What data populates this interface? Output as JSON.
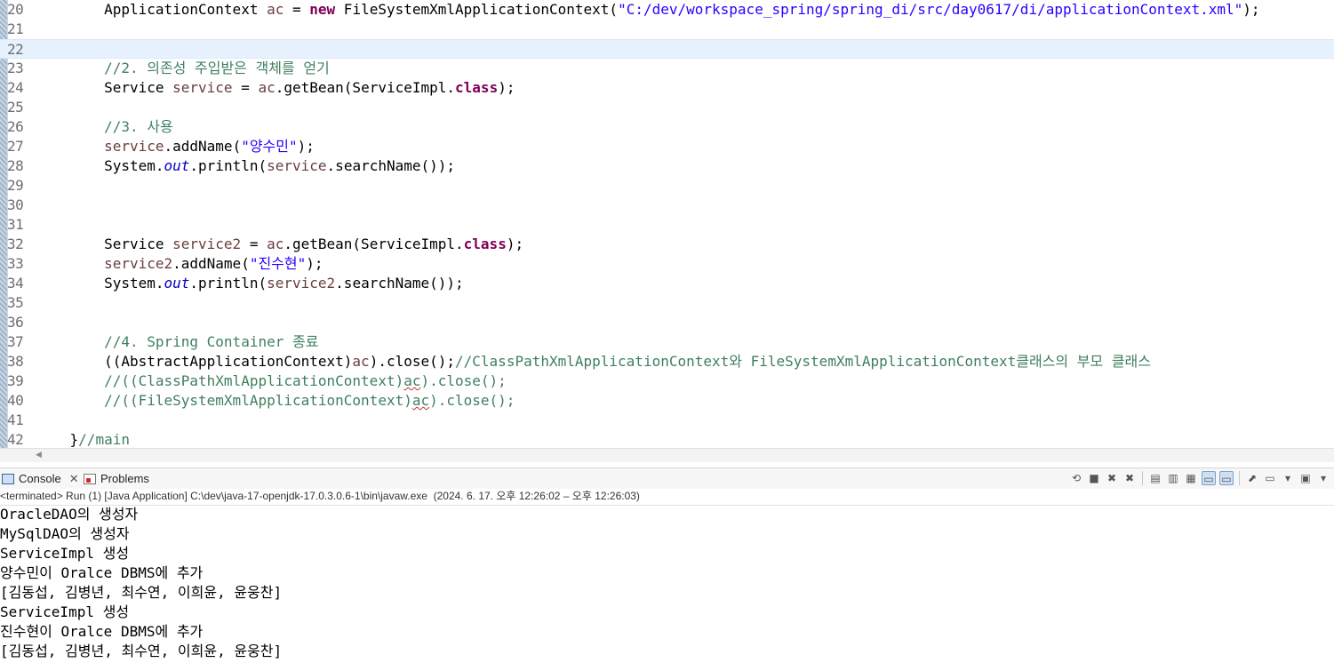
{
  "editor": {
    "lines": [
      {
        "num": "20",
        "segments": [
          {
            "t": "        ApplicationContext "
          },
          {
            "t": "ac",
            "c": "var"
          },
          {
            "t": " = "
          },
          {
            "t": "new",
            "c": "kw"
          },
          {
            "t": " FileSystemXmlApplicationContext("
          },
          {
            "t": "\"C:/dev/workspace_spring/spring_di/src/day0617/di/applicationContext.xml\"",
            "c": "str"
          },
          {
            "t": ");"
          }
        ]
      },
      {
        "num": "21",
        "segments": []
      },
      {
        "num": "22",
        "segments": [],
        "current": true
      },
      {
        "num": "23",
        "segments": [
          {
            "t": "        "
          },
          {
            "t": "//2. 의존성 주입받은 객체를 얻기",
            "c": "cm"
          }
        ]
      },
      {
        "num": "24",
        "segments": [
          {
            "t": "        Service "
          },
          {
            "t": "service",
            "c": "var"
          },
          {
            "t": " = "
          },
          {
            "t": "ac",
            "c": "var"
          },
          {
            "t": ".getBean(ServiceImpl."
          },
          {
            "t": "class",
            "c": "kw"
          },
          {
            "t": ");"
          }
        ]
      },
      {
        "num": "25",
        "segments": []
      },
      {
        "num": "26",
        "segments": [
          {
            "t": "        "
          },
          {
            "t": "//3. 사용",
            "c": "cm"
          }
        ]
      },
      {
        "num": "27",
        "segments": [
          {
            "t": "        "
          },
          {
            "t": "service",
            "c": "var"
          },
          {
            "t": ".addName("
          },
          {
            "t": "\"양수민\"",
            "c": "str"
          },
          {
            "t": ");"
          }
        ]
      },
      {
        "num": "28",
        "segments": [
          {
            "t": "        System."
          },
          {
            "t": "out",
            "c": "fld"
          },
          {
            "t": ".println("
          },
          {
            "t": "service",
            "c": "var"
          },
          {
            "t": ".searchName());"
          }
        ]
      },
      {
        "num": "29",
        "segments": []
      },
      {
        "num": "30",
        "segments": []
      },
      {
        "num": "31",
        "segments": []
      },
      {
        "num": "32",
        "segments": [
          {
            "t": "        Service "
          },
          {
            "t": "service2",
            "c": "var"
          },
          {
            "t": " = "
          },
          {
            "t": "ac",
            "c": "var"
          },
          {
            "t": ".getBean(ServiceImpl."
          },
          {
            "t": "class",
            "c": "kw"
          },
          {
            "t": ");"
          }
        ]
      },
      {
        "num": "33",
        "segments": [
          {
            "t": "        "
          },
          {
            "t": "service2",
            "c": "var"
          },
          {
            "t": ".addName("
          },
          {
            "t": "\"진수현\"",
            "c": "str"
          },
          {
            "t": ");"
          }
        ]
      },
      {
        "num": "34",
        "segments": [
          {
            "t": "        System."
          },
          {
            "t": "out",
            "c": "fld"
          },
          {
            "t": ".println("
          },
          {
            "t": "service2",
            "c": "var"
          },
          {
            "t": ".searchName());"
          }
        ]
      },
      {
        "num": "35",
        "segments": []
      },
      {
        "num": "36",
        "segments": []
      },
      {
        "num": "37",
        "segments": [
          {
            "t": "        "
          },
          {
            "t": "//4. Spring Container 종료",
            "c": "cm"
          }
        ]
      },
      {
        "num": "38",
        "segments": [
          {
            "t": "        ((AbstractApplicationContext)"
          },
          {
            "t": "ac",
            "c": "var"
          },
          {
            "t": ").close();"
          },
          {
            "t": "//ClassPathXmlApplicationContext와 FileSystemXmlApplicationContext클래스의 부모 클래스",
            "c": "cm"
          }
        ]
      },
      {
        "num": "39",
        "segments": [
          {
            "t": "        "
          },
          {
            "t": "//((ClassPathXmlApplicationContext)",
            "c": "cm"
          },
          {
            "t": "ac",
            "c": "cm err"
          },
          {
            "t": ").close();",
            "c": "cm"
          }
        ]
      },
      {
        "num": "40",
        "segments": [
          {
            "t": "        "
          },
          {
            "t": "//((FileSystemXmlApplicationContext)",
            "c": "cm"
          },
          {
            "t": "ac",
            "c": "cm err"
          },
          {
            "t": ").close();",
            "c": "cm"
          }
        ]
      },
      {
        "num": "41",
        "segments": []
      },
      {
        "num": "42",
        "segments": [
          {
            "t": "    }"
          },
          {
            "t": "//main",
            "c": "cm"
          }
        ]
      }
    ]
  },
  "console_panel": {
    "tabs": [
      {
        "label": "Console",
        "icon": "console-icon",
        "active": true
      },
      {
        "label": "Problems",
        "icon": "problems-icon",
        "active": false
      }
    ],
    "toolbar_icons": [
      "pin-console-icon",
      "terminate-icon",
      "remove-launch-icon",
      "remove-all-terminated-icon",
      "clear-console-icon",
      "scroll-lock-icon",
      "word-wrap-icon",
      "show-on-stdout-icon",
      "show-on-stderr-icon",
      "pin-icon",
      "display-selected-console-icon",
      "open-console-icon"
    ],
    "status": "<terminated> Run (1) [Java Application] C:\\dev\\java-17-openjdk-17.0.3.0.6-1\\bin\\javaw.exe  (2024. 6. 17. 오후 12:26:02 – 오후 12:26:03)",
    "output": [
      "OracleDAO의 생성자",
      "MySqlDAO의 생성자",
      "ServiceImpl 생성",
      "양수민이 Oralce DBMS에 추가",
      "[김동섭, 김병년, 최수연, 이희윤, 윤웅찬]",
      "ServiceImpl 생성",
      "진수현이 Oralce DBMS에 추가",
      "[김동섭, 김병년, 최수연, 이희윤, 윤웅찬]"
    ]
  },
  "colors": {
    "keyword": "#7f0055",
    "string": "#2a00ff",
    "comment": "#3f7f5f",
    "field": "#0000c0",
    "local_var": "#6a3e3e",
    "current_line": "#e8f2fe"
  }
}
